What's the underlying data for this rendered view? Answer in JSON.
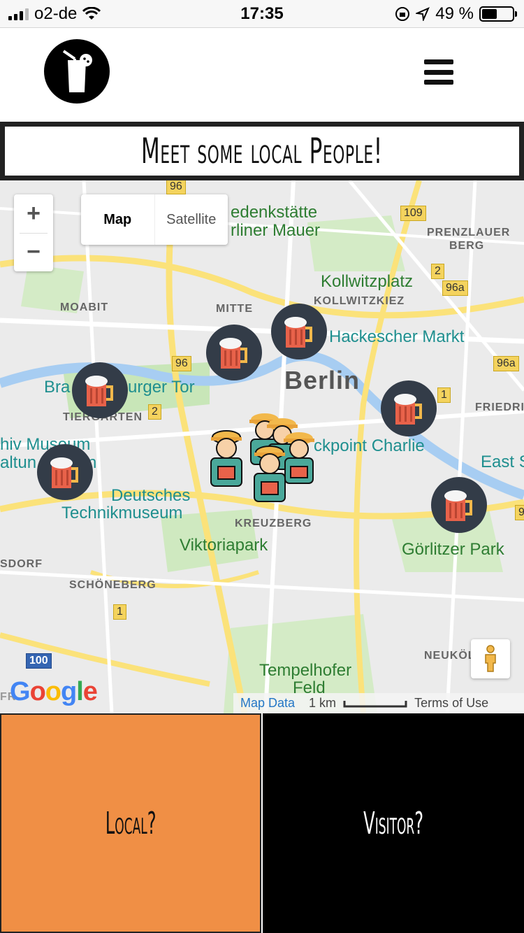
{
  "status_bar": {
    "carrier": "o2-de",
    "time": "17:35",
    "battery": "49 %",
    "battery_level": 0.49
  },
  "header": {
    "logo_icon": "drink-glass-icon",
    "menu_icon": "hamburger-menu-icon"
  },
  "banner": {
    "title": "Meet some local People!"
  },
  "map": {
    "zoom_in": "+",
    "zoom_out": "−",
    "type_map": "Map",
    "type_satellite": "Satellite",
    "labels": {
      "gedenkstaette": "edenkstätte",
      "berliner_mauer": "rliner Mauer",
      "prenzlauer": "PRENZLAUER",
      "berg": "BERG",
      "kollwitzplatz": "Kollwitzplatz",
      "kollwitzkiez": "KOLLWITZKIEZ",
      "moabit": "MOABIT",
      "mitte": "MITTE",
      "hackescher": "Hackescher Markt",
      "berlin": "Berlin",
      "brandenburger_left": "Bra",
      "brandenburger_right": "urger Tor",
      "tiergarten": "TIERGARTEN",
      "friedrich": "FRIEDRIC",
      "museum1": "hiv Museum",
      "museum2": "altun",
      "museum3": "n",
      "checkpoint": "ckpoint Charlie",
      "east": "East S",
      "deutsches": "Deutsches",
      "technikmuseum": "Technikmuseum",
      "kreuzberg": "KREUZBERG",
      "viktoriapark": "Viktoriapark",
      "goerlitzer": "Görlitzer Park",
      "dorf": "SDORF",
      "schoeneberg": "SCHÖNEBERG",
      "neukoelln": "NEUKÖL",
      "tempelhofer": "Tempelhofer",
      "feld": "Feld",
      "fr": "FR"
    },
    "shields": [
      "96",
      "109",
      "2",
      "96a",
      "96",
      "96a",
      "2",
      "1",
      "1",
      "100",
      "9"
    ],
    "google": "Google",
    "map_data": "Map Data",
    "scale": "1 km",
    "terms": "Terms of Use"
  },
  "panels": {
    "local": "Local?",
    "visitor": "Visitor?"
  },
  "colors": {
    "local_panel": "#f08f45",
    "visitor_panel": "#000000",
    "marker_bg": "#333c48",
    "beer": "#e8624a"
  }
}
